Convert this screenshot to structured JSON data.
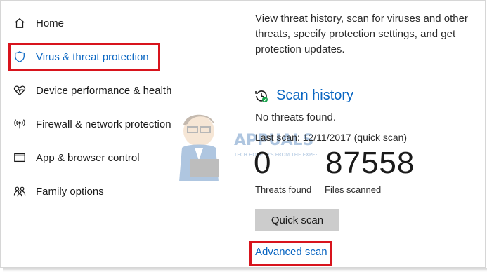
{
  "sidebar": {
    "items": [
      {
        "label": "Home",
        "icon": "home-icon",
        "selected": false
      },
      {
        "label": "Virus & threat protection",
        "icon": "shield-icon",
        "selected": true
      },
      {
        "label": "Device performance & health",
        "icon": "heart-icon",
        "selected": false
      },
      {
        "label": "Firewall & network protection",
        "icon": "antenna-icon",
        "selected": false
      },
      {
        "label": "App & browser control",
        "icon": "window-icon",
        "selected": false
      },
      {
        "label": "Family options",
        "icon": "people-icon",
        "selected": false
      }
    ]
  },
  "main": {
    "description": "View threat history, scan for viruses and other threats, specify protection settings, and get protection updates.",
    "scan_history": {
      "title": "Scan history",
      "icon": "history-check-icon",
      "status": "No threats found.",
      "last_scan": "Last scan: 12/11/2017 (quick scan)",
      "threats_found": {
        "value": "0",
        "label": "Threats found"
      },
      "files_scanned": {
        "value": "87558",
        "label": "Files scanned"
      },
      "quick_scan_label": "Quick scan",
      "advanced_scan_label": "Advanced scan"
    }
  },
  "watermark": {
    "brand": "APPUALS",
    "tagline": "TECH HOW-TO'S FROM THE EXPERTS!"
  },
  "colors": {
    "accent": "#0a66c2",
    "highlight_border": "#d8141d",
    "button_bg": "#cccccc"
  }
}
